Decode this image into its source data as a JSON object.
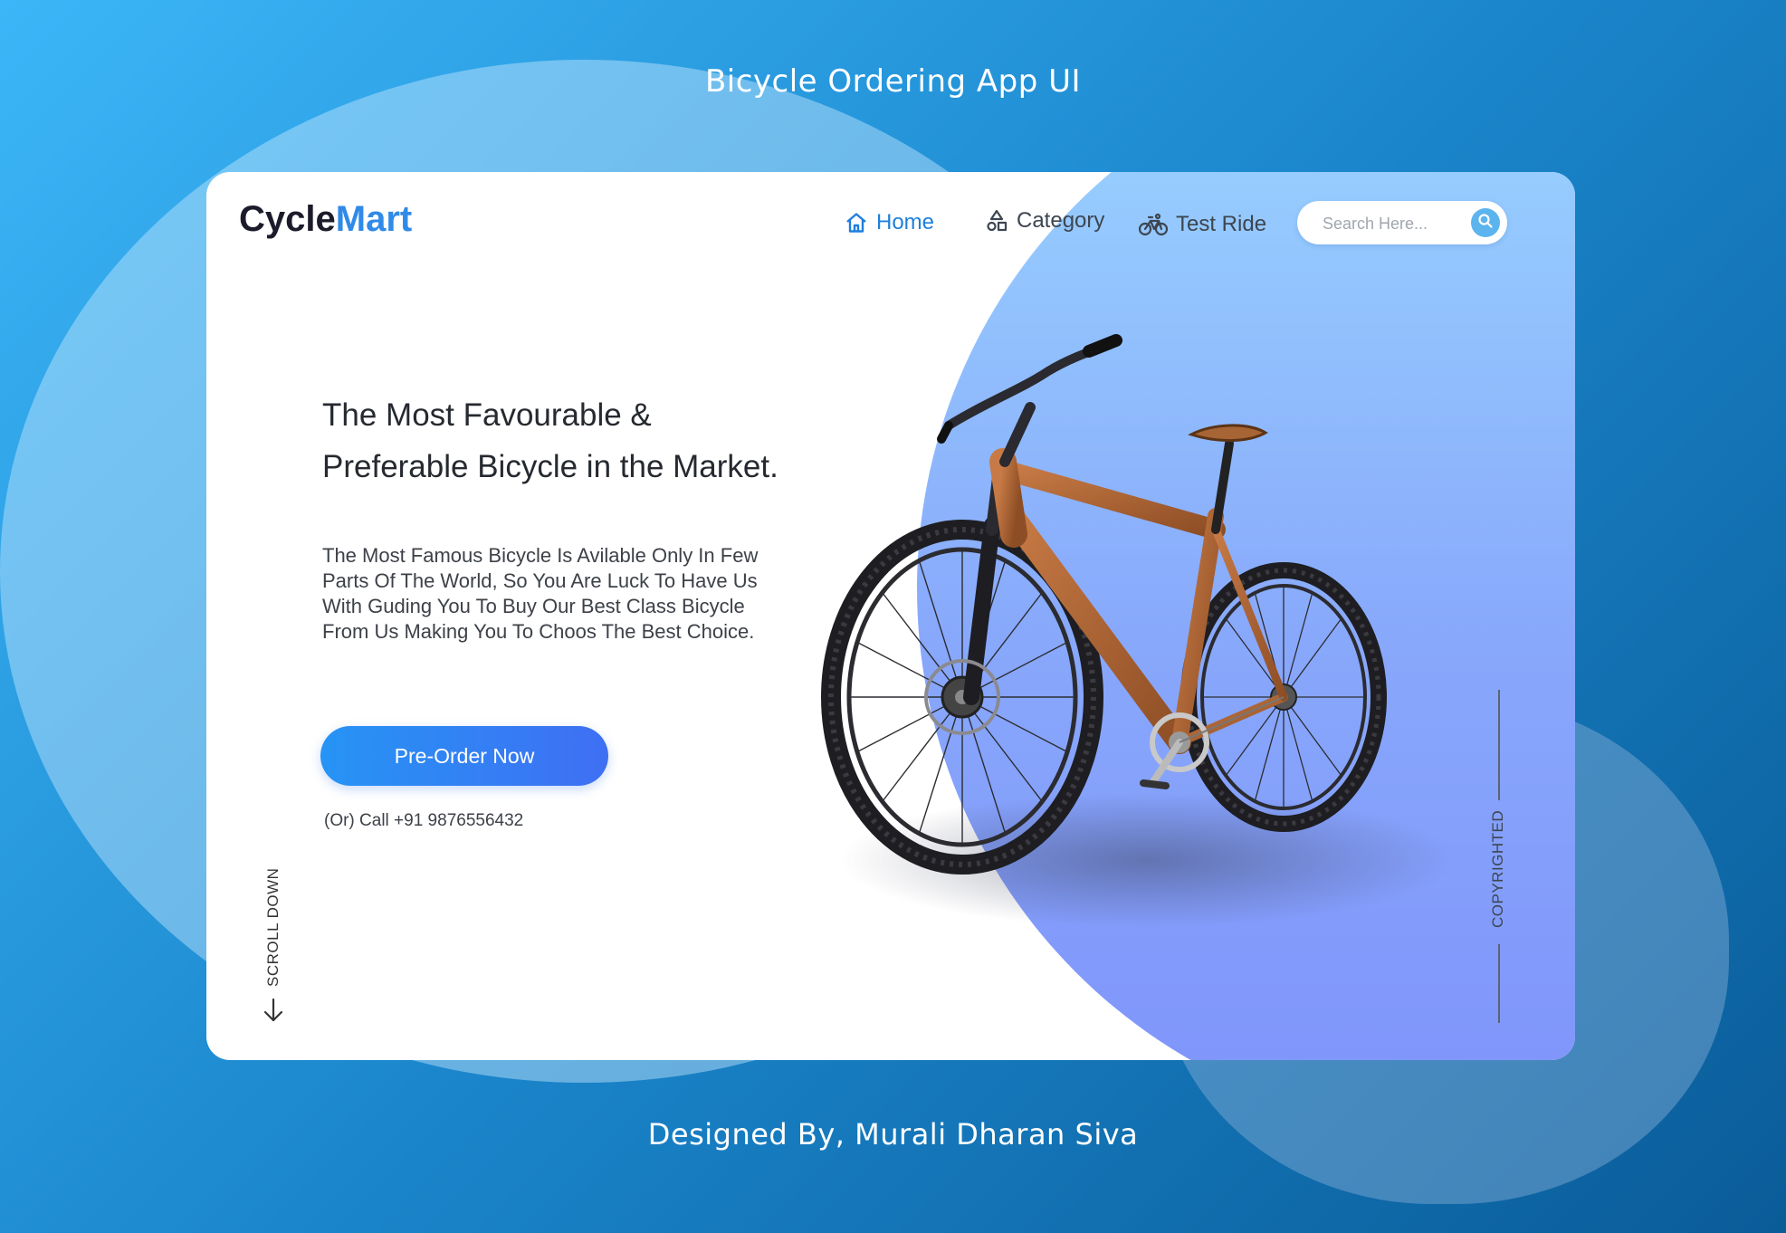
{
  "page": {
    "heading": "Bicycle Ordering App UI",
    "credit": "Designed By, Murali Dharan Siva"
  },
  "brand": {
    "logo_part1": "Cycle",
    "logo_part2": "Mart",
    "accent_color": "#2f8ae8"
  },
  "nav": {
    "items": [
      {
        "label": "Home",
        "icon": "home-icon",
        "active": true
      },
      {
        "label": "Category",
        "icon": "category-icon",
        "active": false
      },
      {
        "label": "Test Ride",
        "icon": "bicycle-icon",
        "active": false
      }
    ]
  },
  "search": {
    "placeholder": "Search Here...",
    "icon": "search-icon"
  },
  "hero": {
    "headline_line1": "The Most Favourable &",
    "headline_line2": "Preferable Bicycle in the Market.",
    "description": "The Most Famous Bicycle Is Avilable Only In Few Parts Of The World, So You Are Luck To Have Us With Guding You To Buy Our Best Class Bicycle From Us Making You To Choos The Best Choice.",
    "cta_label": "Pre-Order Now",
    "call_text": "(Or) Call +91 9876556432"
  },
  "side": {
    "scroll_label": "SCROLL DOWN",
    "copyright_label": "COPYRIGHTED"
  }
}
